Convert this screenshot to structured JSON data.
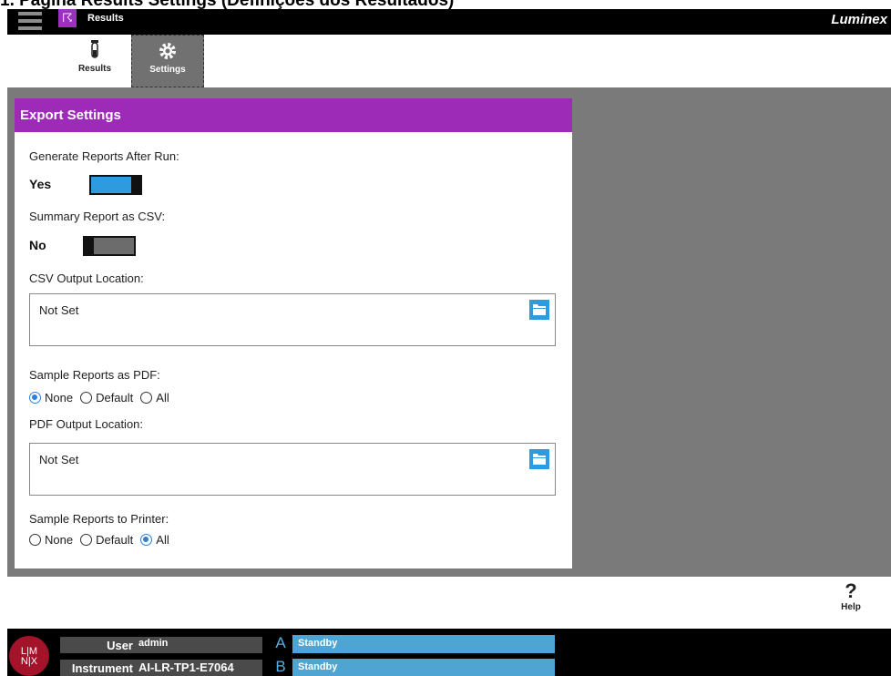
{
  "doc_caption": "1. Página Results Settings (Definições dos Resultados)",
  "topbar": {
    "app_title": "Results",
    "brand": "Luminex",
    "app_icon": "dna-icon"
  },
  "tabs": [
    {
      "label": "Results",
      "icon": "test-tube-icon",
      "active": false
    },
    {
      "label": "Settings",
      "icon": "gear-icon",
      "active": true
    }
  ],
  "panel": {
    "title": "Export Settings",
    "generate_reports": {
      "label": "Generate Reports After Run:",
      "value": "Yes",
      "enabled": true
    },
    "summary_csv": {
      "label": "Summary Report as CSV:",
      "value": "No",
      "enabled": false
    },
    "csv_location": {
      "label": "CSV Output Location:",
      "value": "Not Set"
    },
    "sample_pdf": {
      "label": "Sample Reports as PDF:",
      "options": [
        "None",
        "Default",
        "All"
      ],
      "selected": "None"
    },
    "pdf_location": {
      "label": "PDF Output Location:",
      "value": "Not Set"
    },
    "sample_printer": {
      "label": "Sample Reports to Printer:",
      "options": [
        "None",
        "Default",
        "All"
      ],
      "selected": "All"
    }
  },
  "help": {
    "symbol": "?",
    "label": "Help"
  },
  "status": {
    "logo_text": "L|M N|X",
    "user_label": "User",
    "user_value": "admin",
    "instrument_label": "Instrument",
    "instrument_value": "AI-LR-TP1-E7064",
    "modules": [
      {
        "letter": "A",
        "state": "Standby"
      },
      {
        "letter": "B",
        "state": "Standby"
      }
    ]
  },
  "colors": {
    "accent": "#9d2bb8",
    "toggle_on": "#2e9be0",
    "toggle_off": "#6c6c6c",
    "status_bar": "#4ea4d2"
  }
}
